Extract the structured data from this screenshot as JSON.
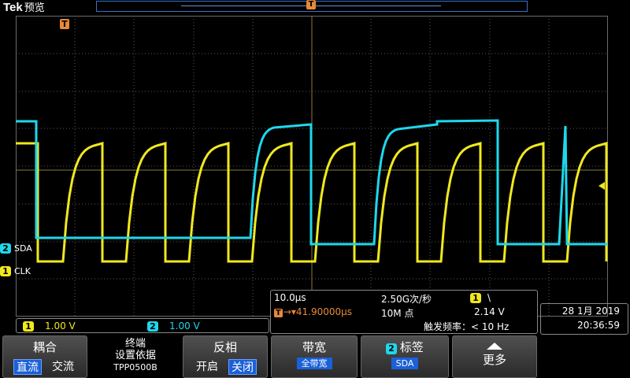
{
  "topbar": {
    "brand": "Tek",
    "mode": "预览",
    "trigger_marker": "T"
  },
  "display": {
    "trigger_position_marker": "T",
    "colors": {
      "ch1": "#f0e81e",
      "ch2": "#1ed8ec",
      "trigger": "#e8893a",
      "grid": "#6a6a6a"
    },
    "channels": {
      "ch2": {
        "number": "2",
        "label": "SDA"
      },
      "ch1": {
        "number": "1",
        "label": "CLK"
      }
    }
  },
  "acquisition": {
    "horizontal_scale": "10.0µs",
    "horizontal_position": "41.90000µs",
    "sample_rate": "2.50G次/秒",
    "record_length": "10M 点",
    "trigger_source": "1",
    "trigger_slope": "\\",
    "trigger_level": "2.14 V",
    "trigger_freq": "触发频率：< 10 Hz"
  },
  "datetime": {
    "date": "28 1月 2019",
    "time": "20:36:59"
  },
  "vertical": {
    "ch1": {
      "number": "1",
      "scale": "1.00 V"
    },
    "ch2": {
      "number": "2",
      "scale": "1.00 V"
    }
  },
  "menu": {
    "coupling": {
      "title": "耦合",
      "opt_dc": "直流",
      "opt_ac": "交流"
    },
    "termination": {
      "line1": "终端",
      "line2": "设置依据",
      "line3": "TPP0500B"
    },
    "invert": {
      "title": "反相",
      "opt_on": "开启",
      "opt_off": "关闭"
    },
    "bandwidth": {
      "title": "带宽",
      "value": "全带宽"
    },
    "label": {
      "ch": "2",
      "title": "标签",
      "value": "SDA"
    },
    "more": {
      "title": "更多"
    }
  }
}
